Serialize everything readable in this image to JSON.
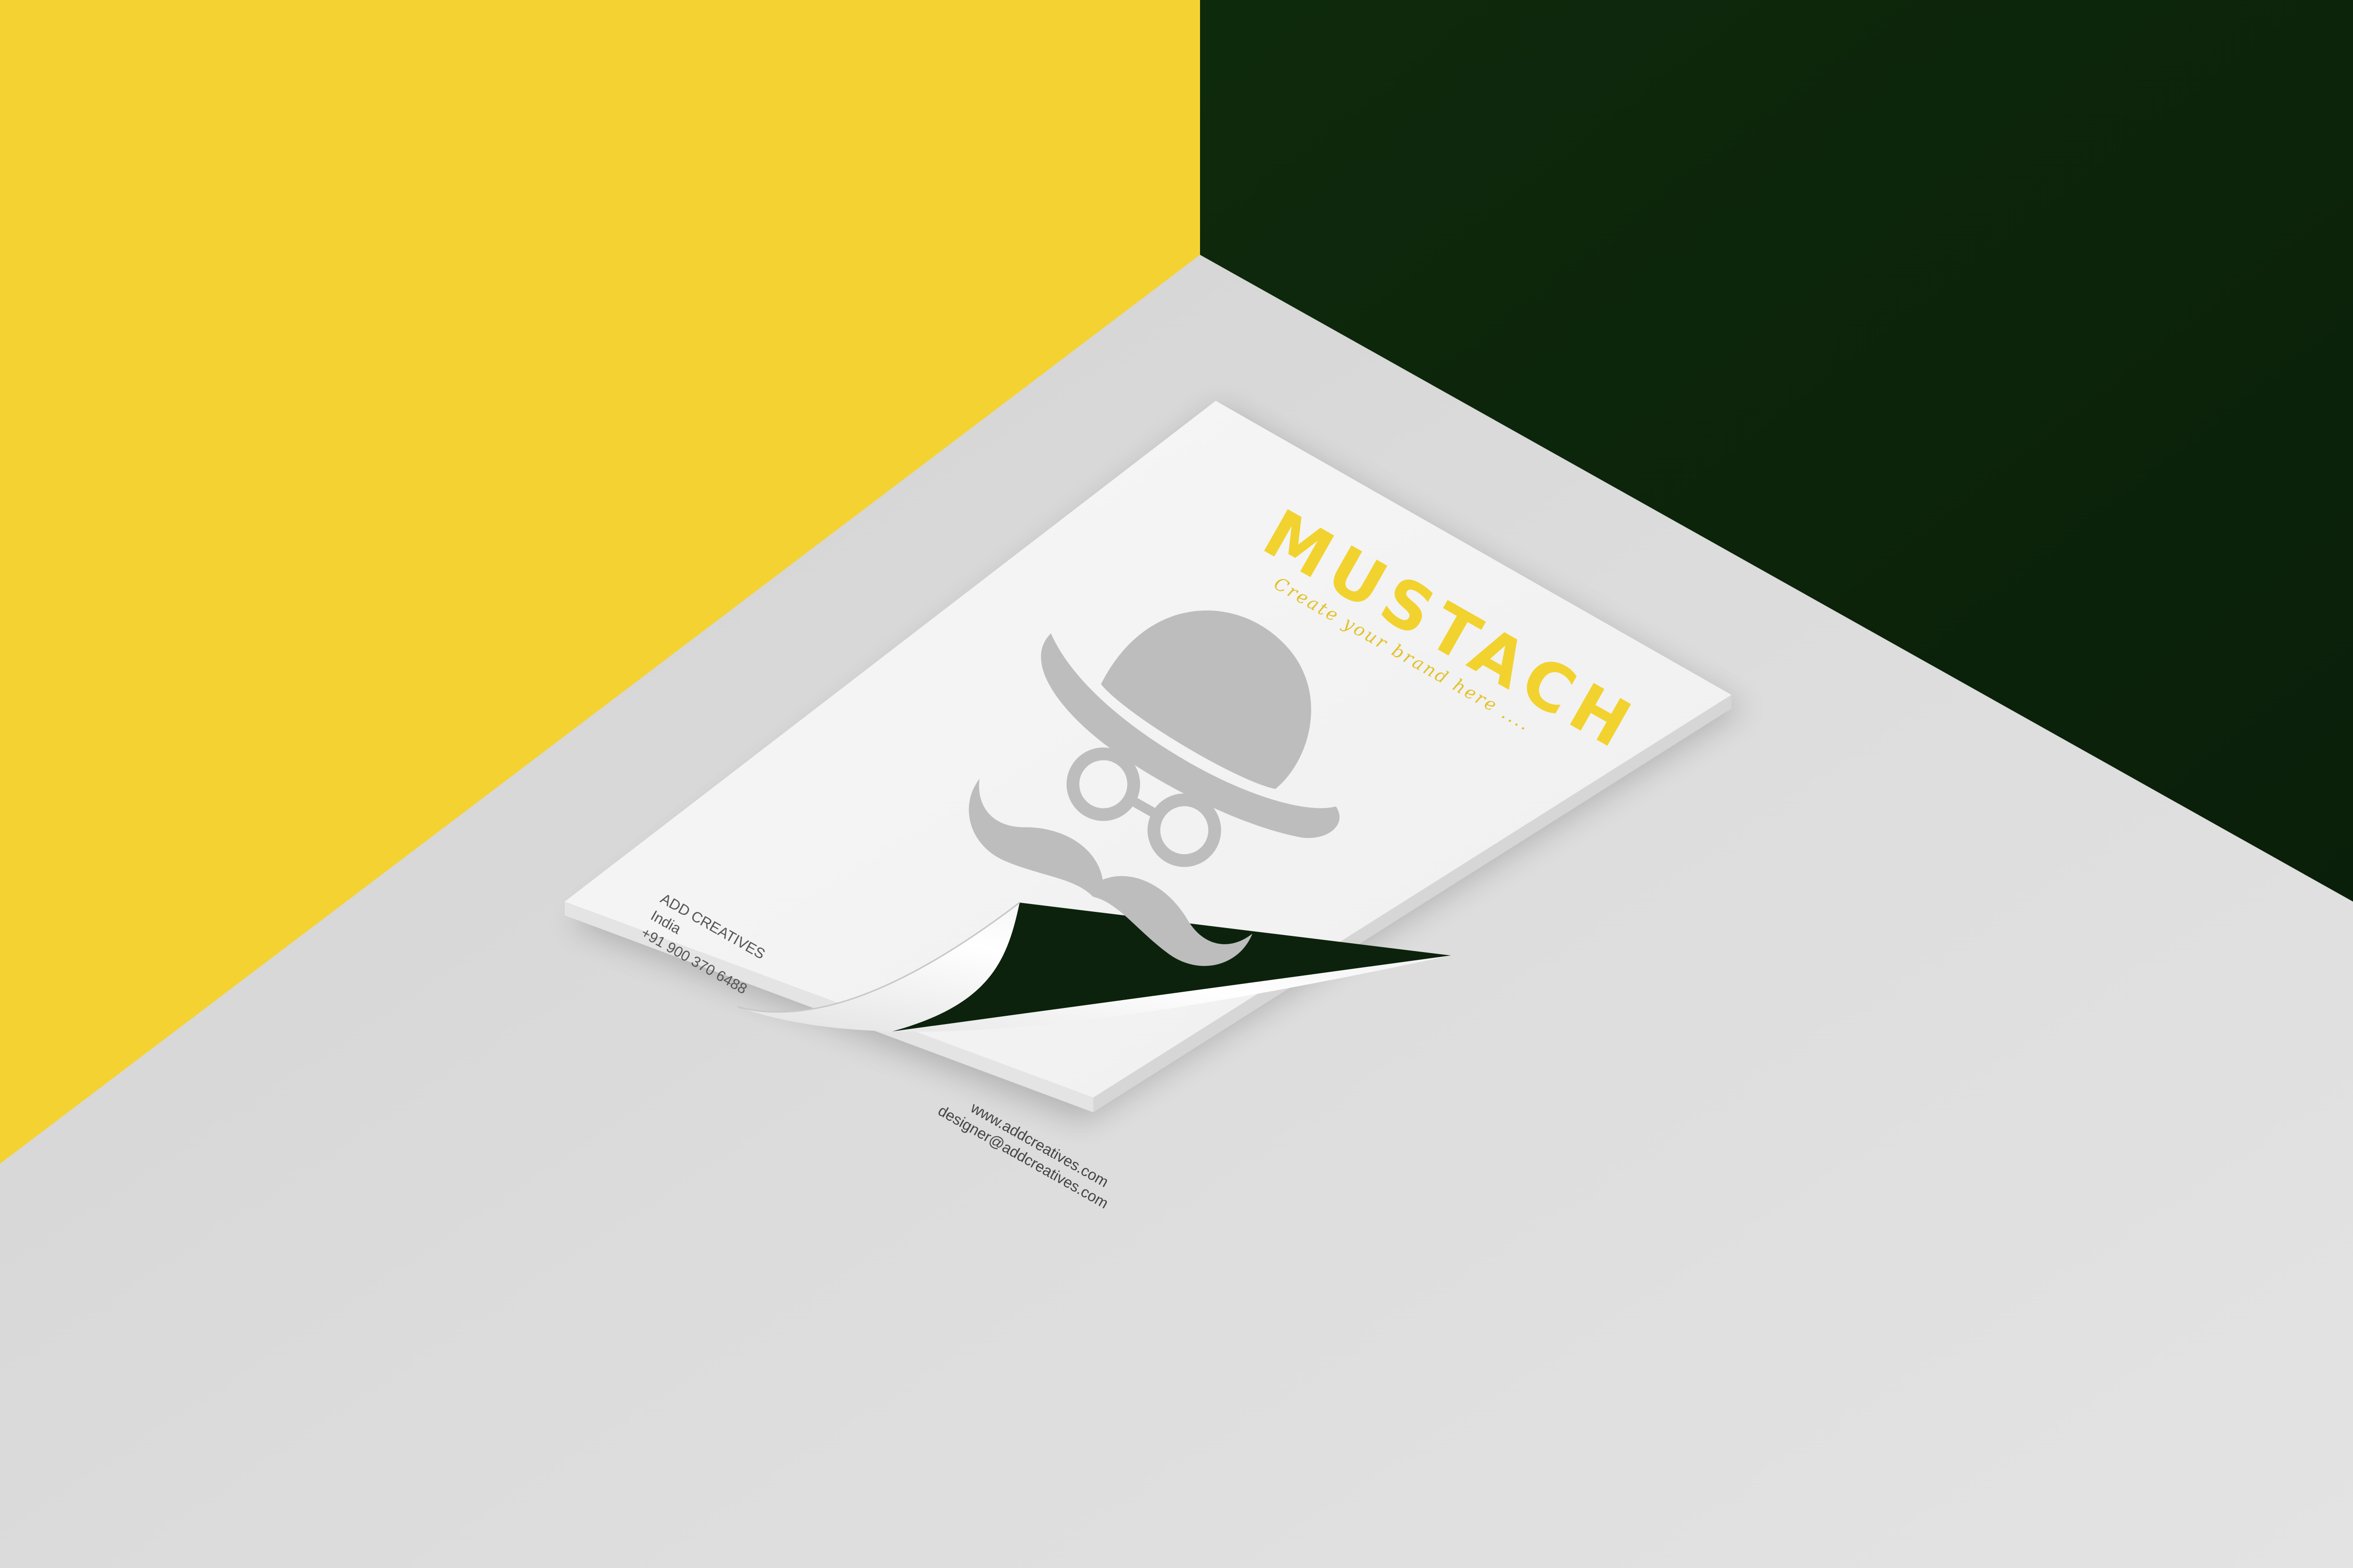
{
  "letterhead": {
    "brand": {
      "name": "MUSTACH",
      "tagline": "Create your brand here ....",
      "color": "#f2d22e"
    },
    "address": {
      "line1": "ADD CREATIVES",
      "line2": "India",
      "line3": "+91 900 370 6488"
    },
    "contact": {
      "website": "www.addcreatives.com",
      "email": "designer@addcreatives.com"
    },
    "logo": {
      "icon": "gentleman-bowler-hat-glasses-mustache-icon",
      "color": "#bdbdbd"
    }
  },
  "backdrop": {
    "left_wall_color": "#f4d232",
    "right_wall_color": "#0c260b",
    "floor_color": "#d9d9d9",
    "under_curl_color": "#0c220c"
  }
}
